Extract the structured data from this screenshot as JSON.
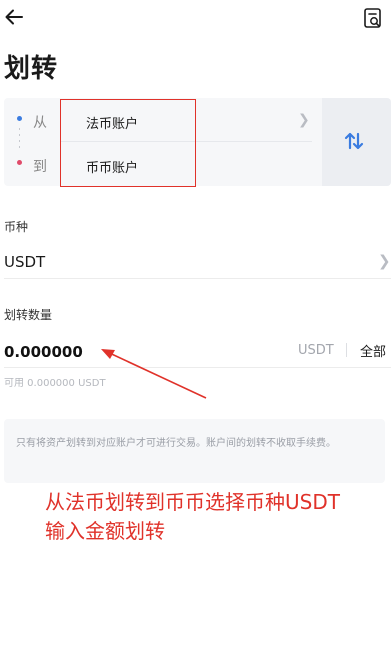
{
  "page": {
    "title": "划转"
  },
  "transfer": {
    "from_label": "从",
    "from_account": "法币账户",
    "to_label": "到",
    "to_account": "币币账户"
  },
  "coin": {
    "label": "币种",
    "value": "USDT"
  },
  "amount": {
    "label": "划转数量",
    "value": "0.000000",
    "unit": "USDT",
    "max_label": "全部",
    "available": "可用 0.000000 USDT"
  },
  "notice": {
    "text": "只有将资产划转到对应账户才可进行交易。账户间的划转不收取手续费。"
  },
  "annotation": {
    "line1": "从法币划转到币币选择币种USDT",
    "line2": "输入金额划转"
  },
  "icons": {
    "back": "back-arrow-icon",
    "records": "transfer-records-icon",
    "swap": "swap-arrows-icon",
    "chevron": "chevron-right-icon"
  },
  "colors": {
    "swap_accent": "#3b7ce0",
    "annotation_red": "#e0322a",
    "from_dot": "#3b7ce0",
    "to_dot": "#e04b6a"
  }
}
